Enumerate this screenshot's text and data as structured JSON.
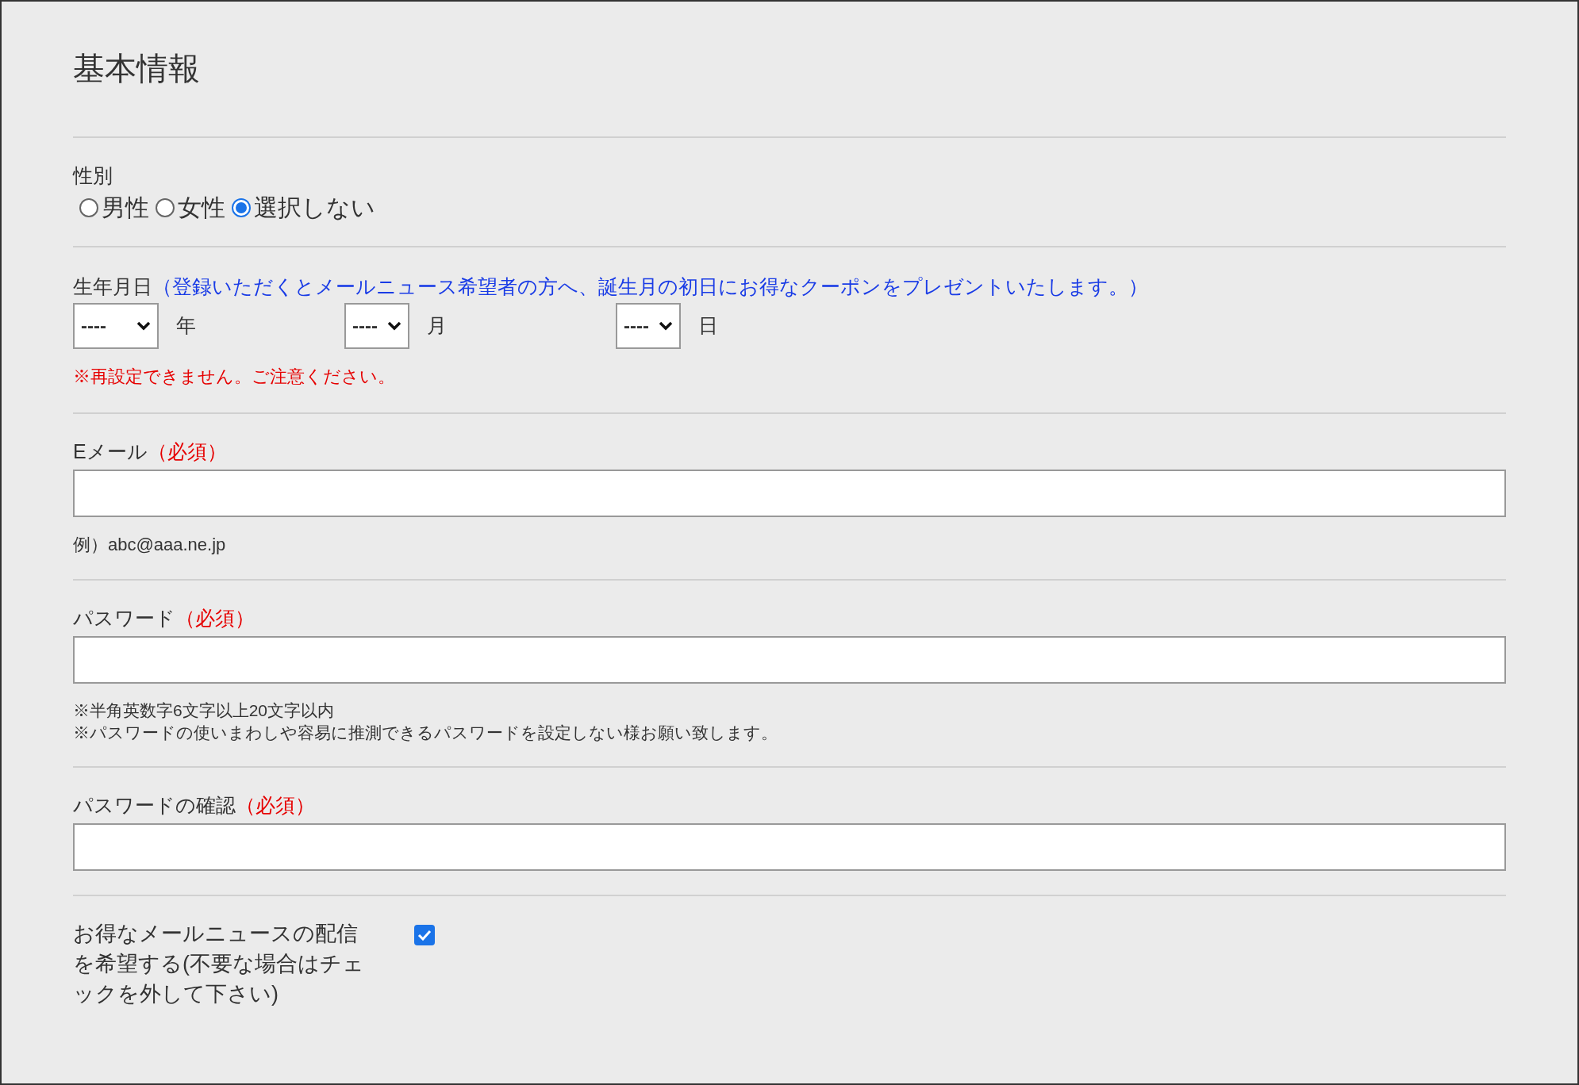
{
  "title": "基本情報",
  "gender": {
    "label": "性別",
    "options": [
      {
        "label": "男性",
        "selected": false
      },
      {
        "label": "女性",
        "selected": false
      },
      {
        "label": "選択しない",
        "selected": true
      }
    ]
  },
  "birthday": {
    "label": "生年月日",
    "note": "（登録いただくとメールニュース希望者の方へ、誕生月の初日にお得なクーポンをプレゼントいたします。）",
    "selects": [
      {
        "value": "----",
        "unit": "年",
        "kind": "wide"
      },
      {
        "value": "----",
        "unit": "月",
        "kind": "narrow"
      },
      {
        "value": "----",
        "unit": "日",
        "kind": "narrow"
      }
    ],
    "warning": "※再設定できません。ご注意ください。"
  },
  "email": {
    "label": "Eメール",
    "required": "（必須）",
    "hint": "例）abc@aaa.ne.jp"
  },
  "password": {
    "label": "パスワード",
    "required": "（必須）",
    "notes": [
      "※半角英数字6文字以上20文字以内",
      "※パスワードの使いまわしや容易に推測できるパスワードを設定しない様お願い致します。"
    ]
  },
  "password_confirm": {
    "label": "パスワードの確認",
    "required": "（必須）"
  },
  "newsletter": {
    "label": "お得なメールニュースの配信を希望する(不要な場合はチェックを外して下さい)",
    "checked": true
  }
}
